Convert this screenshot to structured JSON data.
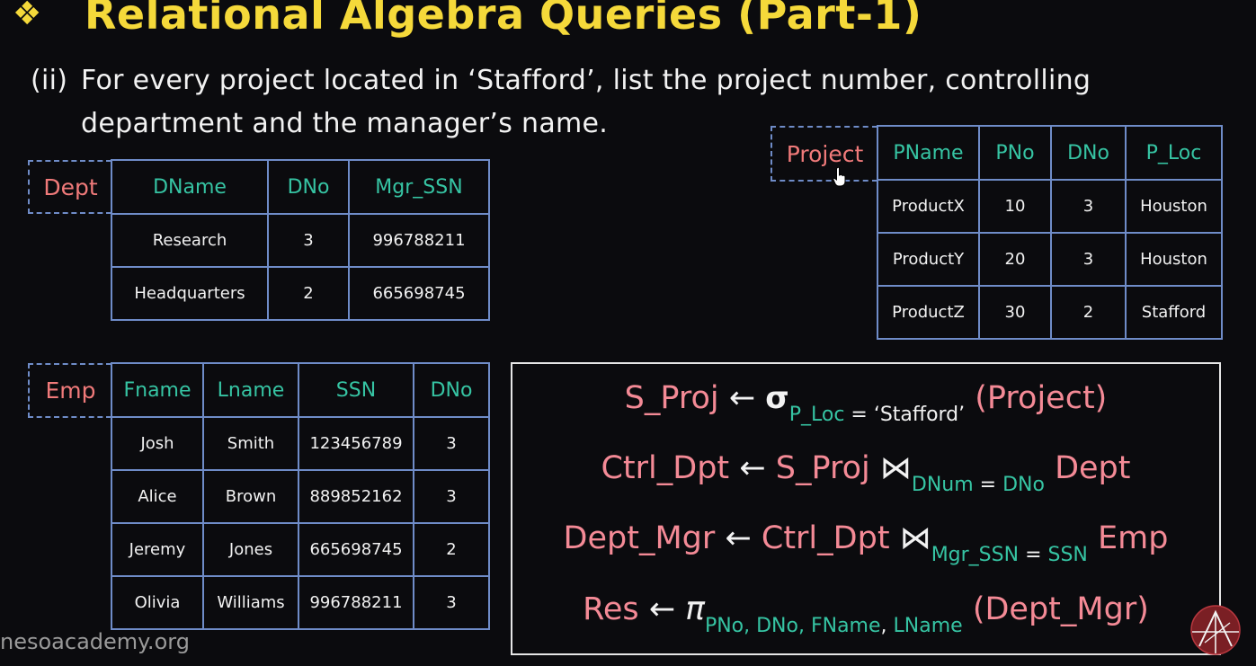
{
  "title": "Relational Algebra Queries (Part-1)",
  "title_icon": "diamond-bullet-icon",
  "question": {
    "number": "(ii)",
    "line1": "For every project located in ‘Stafford’, list the project number, controlling",
    "line2": "department and the manager’s name."
  },
  "dept": {
    "label": "Dept",
    "headers": [
      "DName",
      "DNo",
      "Mgr_SSN"
    ],
    "rows": [
      [
        "Research",
        "3",
        "996788211"
      ],
      [
        "Headquarters",
        "2",
        "665698745"
      ]
    ]
  },
  "project": {
    "label": "Project",
    "headers": [
      "PName",
      "PNo",
      "DNo",
      "P_Loc"
    ],
    "rows": [
      [
        "ProductX",
        "10",
        "3",
        "Houston"
      ],
      [
        "ProductY",
        "20",
        "3",
        "Houston"
      ],
      [
        "ProductZ",
        "30",
        "2",
        "Stafford"
      ]
    ]
  },
  "emp": {
    "label": "Emp",
    "headers": [
      "Fname",
      "Lname",
      "SSN",
      "DNo"
    ],
    "rows": [
      [
        "Josh",
        "Smith",
        "123456789",
        "3"
      ],
      [
        "Alice",
        "Brown",
        "889852162",
        "3"
      ],
      [
        "Jeremy",
        "Jones",
        "665698745",
        "2"
      ],
      [
        "Olivia",
        "Williams",
        "996788211",
        "3"
      ]
    ]
  },
  "algebra": {
    "eq1": {
      "lhs": "S_Proj",
      "arrow": "←",
      "op": "σ",
      "cond_attr": "P_Loc",
      "cond_rest": " = ‘Stafford’",
      "rhs": "(Project)"
    },
    "eq2": {
      "lhs": "Ctrl_Dpt",
      "arrow": "←",
      "left": "S_Proj",
      "op": "⋈",
      "cond_a": "DNum",
      "cond_eq": " = ",
      "cond_b": "DNo",
      "right": "Dept"
    },
    "eq3": {
      "lhs": "Dept_Mgr",
      "arrow": "←",
      "left": "Ctrl_Dpt",
      "op": "⋈",
      "cond_a": "Mgr_SSN",
      "cond_eq": " = ",
      "cond_b": "SSN",
      "right": "Emp"
    },
    "eq4": {
      "lhs": "Res",
      "arrow": "←",
      "op": "π",
      "attrs": "PNo, DNo, FName",
      "comma": ", ",
      "attr_last": "LName",
      "rhs": "(Dept_Mgr)"
    }
  },
  "watermark": "nesoacademy.org",
  "logo_icon": "neso-logo-icon",
  "colors": {
    "title": "#f5d93a",
    "header": "#36c4a3",
    "label": "#f07a7a",
    "border": "#6f8cc8",
    "expr": "#f48a96"
  }
}
